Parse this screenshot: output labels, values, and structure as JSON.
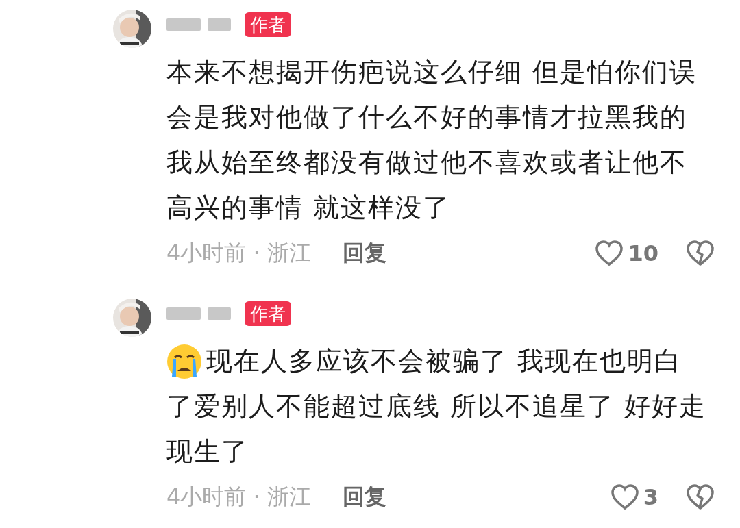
{
  "comments": [
    {
      "badge": "作者",
      "crying_emoji": false,
      "text": "本来不想揭开伤疤说这么仔细 但是怕你们误会是我对他做了什么不好的事情才拉黑我的我从始至终都没有做过他不喜欢或者让他不高兴的事情 就这样没了",
      "meta": "4小时前 · 浙江",
      "reply": "回复",
      "likes": "10"
    },
    {
      "badge": "作者",
      "crying_emoji": true,
      "text": "现在人多应该不会被骗了 我现在也明白了爱别人不能超过底线 所以不追星了 好好走现生了",
      "meta": "4小时前 · 浙江",
      "reply": "回复",
      "likes": "3"
    }
  ]
}
